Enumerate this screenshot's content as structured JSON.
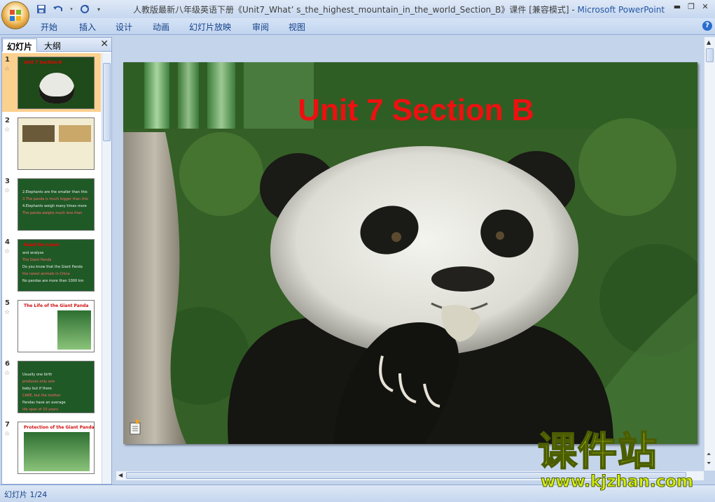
{
  "window": {
    "title": "人教版最新八年级英语下册《Unit7_What’ s_the_highest_mountain_in_the_world_Section_B》课件 [兼容模式] - ",
    "app_name": "Microsoft PowerPoint"
  },
  "ribbon": {
    "tabs": [
      "开始",
      "插入",
      "设计",
      "动画",
      "幻灯片放映",
      "审阅",
      "视图"
    ]
  },
  "pane": {
    "tabs": [
      "幻灯片",
      "大纲"
    ],
    "close": "✕"
  },
  "thumbnails": [
    {
      "num": "1",
      "title": "Unit 7 Section B",
      "bg": "#1f4a1a",
      "lines": []
    },
    {
      "num": "2",
      "title": "",
      "bg": "#f2ecd2",
      "lines": []
    },
    {
      "num": "3",
      "title": "",
      "bg": "#1f5a26",
      "lines": [
        "2.Elephants are the smaller than this",
        "3.The panda is much bigger than this",
        "4.Elephants weigh many times more",
        "The panda weighs much less than"
      ]
    },
    {
      "num": "4",
      "title": "Read the exam",
      "bg": "#1f5a26",
      "lines": [
        "and analyse",
        "   The Giant Panda",
        "Do you know that the Giant Panda",
        "the rarest animals in China",
        "No pandas are more than 1000 km"
      ]
    },
    {
      "num": "5",
      "title": "The Life of  the Giant  Panda",
      "bg": "#ffffff",
      "lines": []
    },
    {
      "num": "6",
      "title": "",
      "bg": "#1f5a26",
      "lines": [
        "Usually one birth",
        "produces only one",
        "baby but if there",
        "CARE, but the mother",
        "Pandas have an average",
        "life span of 10 years"
      ]
    },
    {
      "num": "7",
      "title": "Protection of the Giant Panda",
      "bg": "#ffffff",
      "lines": []
    }
  ],
  "slide": {
    "title": "Unit 7 Section B"
  },
  "status": {
    "text": "幻灯片 1/24"
  },
  "watermark": {
    "cn": "课件站",
    "url": "www.kjzhan.com"
  },
  "colors": {
    "accent": "#15428b",
    "title_red": "#ee1010",
    "slide_green": "#1f4a1a",
    "watermark": "#d7ef12"
  }
}
